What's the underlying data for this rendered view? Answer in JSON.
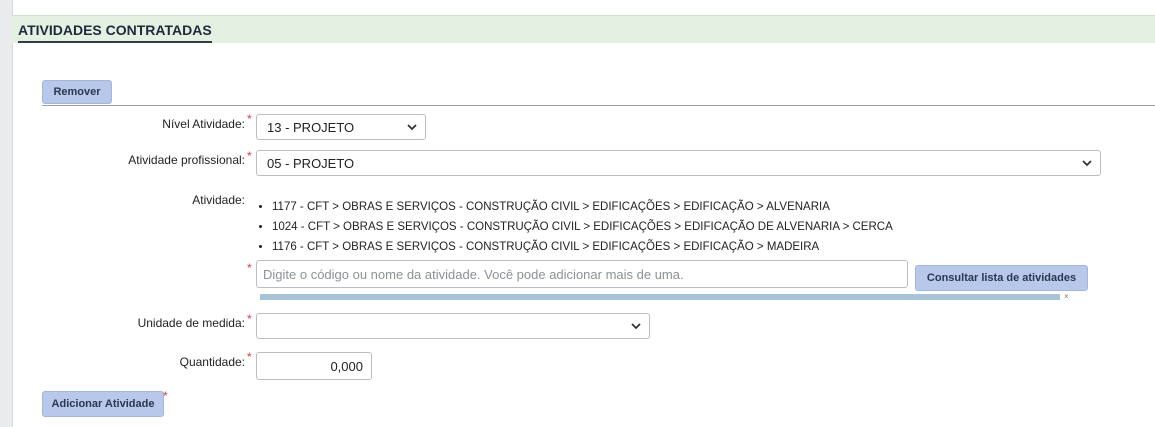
{
  "section": {
    "title": "ATIVIDADES CONTRATADAS"
  },
  "remove_button": {
    "label": "Remover"
  },
  "nivel": {
    "label": "Nível Atividade:",
    "value": "13 - PROJETO"
  },
  "atividade_profissional": {
    "label": "Atividade profissional:",
    "value": "05 - PROJETO"
  },
  "atividade": {
    "label": "Atividade:",
    "items": [
      "1177 - CFT > OBRAS E SERVIÇOS - CONSTRUÇÃO CIVIL > EDIFICAÇÕES > EDIFICAÇÃO > ALVENARIA",
      "1024 - CFT > OBRAS E SERVIÇOS - CONSTRUÇÃO CIVIL > EDIFICAÇÕES > EDIFICAÇÃO DE ALVENARIA > CERCA",
      "1176 - CFT > OBRAS E SERVIÇOS - CONSTRUÇÃO CIVIL > EDIFICAÇÕES > EDIFICAÇÃO > MADEIRA"
    ],
    "search_placeholder": "Digite o código ou nome da atividade. Você pode adicionar mais de uma.",
    "consult_button": "Consultar lista de atividades"
  },
  "unidade": {
    "label": "Unidade de medida:",
    "value": ""
  },
  "quantidade": {
    "label": "Quantidade:",
    "value": "0,000"
  },
  "add_button": {
    "label": "Adicionar Atividade"
  },
  "required_mark": "*",
  "colors": {
    "header_bg": "#e4f1e2",
    "button_bg": "#b8c8ea",
    "required": "#e03a3a"
  }
}
